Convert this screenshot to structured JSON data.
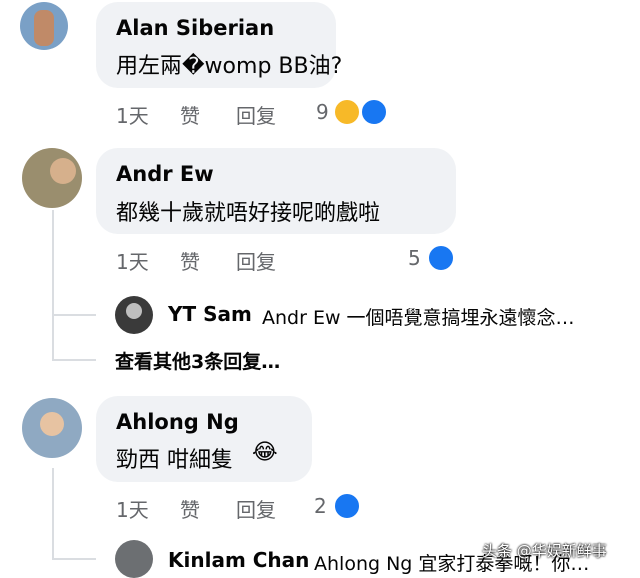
{
  "comments": [
    {
      "author": "Alan Siberian",
      "text": "用左兩�womp BB油?",
      "time": "1天",
      "like_label": "赞",
      "reply_label": "回复",
      "reaction_count": "9",
      "reactions": [
        "haha-reaction-icon",
        "like-reaction-icon"
      ]
    },
    {
      "author": "Andr Ew",
      "text": "都幾十歲就唔好接呢啲戲啦",
      "time": "1天",
      "like_label": "赞",
      "reply_label": "回复",
      "reaction_count": "5",
      "reactions": [
        "like-reaction-icon"
      ],
      "reply_preview": {
        "author": "YT Sam",
        "text": "Andr Ew 一個唔覺意搞埋永遠懷念…"
      },
      "more_replies": "查看其他3条回复…"
    },
    {
      "author": "Ahlong Ng",
      "text": "勁西 咁細隻",
      "emoji": "😂",
      "time": "1天",
      "like_label": "赞",
      "reply_label": "回复",
      "reaction_count": "2",
      "reactions": [
        "like-reaction-icon"
      ],
      "reply_preview": {
        "author": "Kinlam Chan",
        "text": "Ahlong Ng 宜家打泰拳嘅！你…"
      }
    }
  ],
  "watermark": "头条 @华娱新鲜事",
  "colors": {
    "bubble": "#f0f2f5",
    "like": "#1877f2",
    "muted": "#65676b"
  }
}
